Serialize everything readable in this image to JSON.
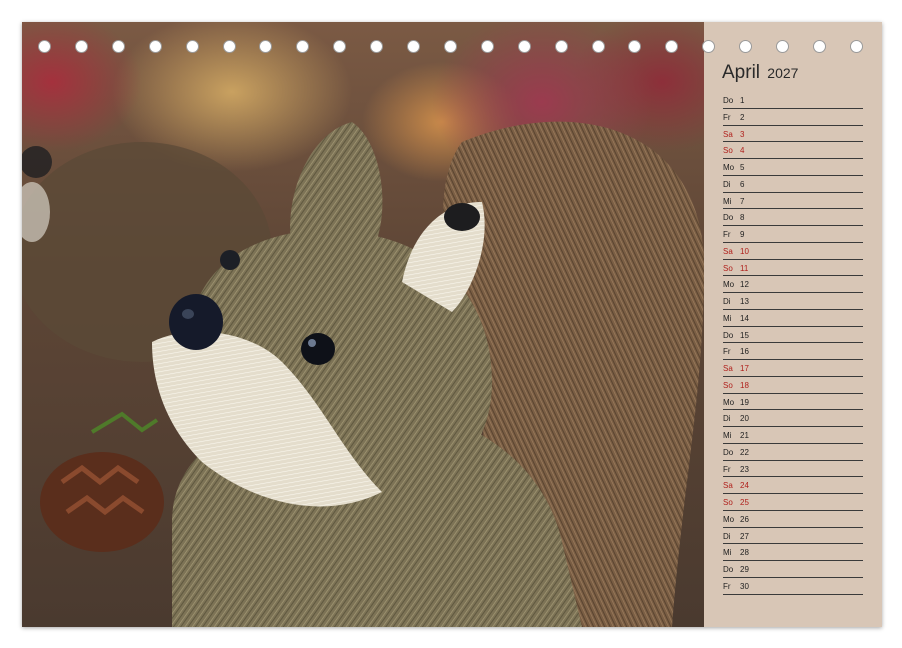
{
  "calendar": {
    "month": "April",
    "year": "2027",
    "days": [
      {
        "wd": "Do",
        "num": "1",
        "weekend": false
      },
      {
        "wd": "Fr",
        "num": "2",
        "weekend": false
      },
      {
        "wd": "Sa",
        "num": "3",
        "weekend": true
      },
      {
        "wd": "So",
        "num": "4",
        "weekend": true
      },
      {
        "wd": "Mo",
        "num": "5",
        "weekend": false
      },
      {
        "wd": "Di",
        "num": "6",
        "weekend": false
      },
      {
        "wd": "Mi",
        "num": "7",
        "weekend": false
      },
      {
        "wd": "Do",
        "num": "8",
        "weekend": false
      },
      {
        "wd": "Fr",
        "num": "9",
        "weekend": false
      },
      {
        "wd": "Sa",
        "num": "10",
        "weekend": true
      },
      {
        "wd": "So",
        "num": "11",
        "weekend": true
      },
      {
        "wd": "Mo",
        "num": "12",
        "weekend": false
      },
      {
        "wd": "Di",
        "num": "13",
        "weekend": false
      },
      {
        "wd": "Mi",
        "num": "14",
        "weekend": false
      },
      {
        "wd": "Do",
        "num": "15",
        "weekend": false
      },
      {
        "wd": "Fr",
        "num": "16",
        "weekend": false
      },
      {
        "wd": "Sa",
        "num": "17",
        "weekend": true
      },
      {
        "wd": "So",
        "num": "18",
        "weekend": true
      },
      {
        "wd": "Mo",
        "num": "19",
        "weekend": false
      },
      {
        "wd": "Di",
        "num": "20",
        "weekend": false
      },
      {
        "wd": "Mi",
        "num": "21",
        "weekend": false
      },
      {
        "wd": "Do",
        "num": "22",
        "weekend": false
      },
      {
        "wd": "Fr",
        "num": "23",
        "weekend": false
      },
      {
        "wd": "Sa",
        "num": "24",
        "weekend": true
      },
      {
        "wd": "So",
        "num": "25",
        "weekend": true
      },
      {
        "wd": "Mo",
        "num": "26",
        "weekend": false
      },
      {
        "wd": "Di",
        "num": "27",
        "weekend": false
      },
      {
        "wd": "Mi",
        "num": "28",
        "weekend": false
      },
      {
        "wd": "Do",
        "num": "29",
        "weekend": false
      },
      {
        "wd": "Fr",
        "num": "30",
        "weekend": false
      }
    ]
  },
  "colors": {
    "panel_background": "#d8c6b6",
    "weekend_text": "#b0201c",
    "weekday_text": "#222222"
  },
  "photo": {
    "subject_icon": "straw-squirrel-figure"
  }
}
